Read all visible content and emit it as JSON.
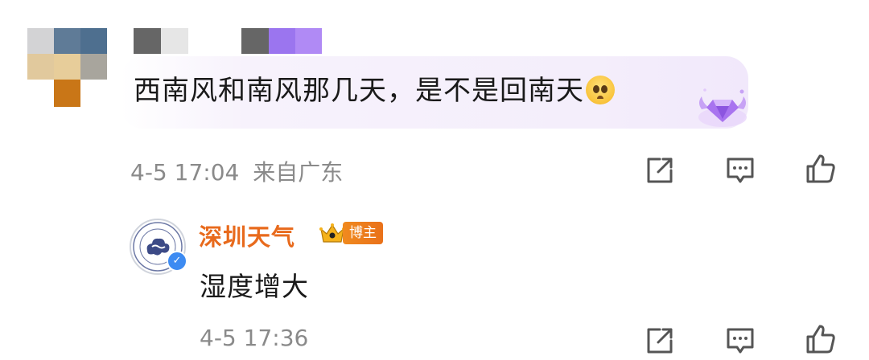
{
  "comment": {
    "text": "西南风和南风那几天，是不是回南天",
    "emoji": "pleading-face-emoji",
    "timestamp": "4-5 17:04",
    "location": "来自广东",
    "avatar_pixel_colors": [
      "#d3d3d5",
      "#5f7b97",
      "#4e6f8f",
      "#a8a59d",
      "#e1c99d",
      "#e7cd9a",
      "#c8b697",
      "#ffffff",
      "#c97617"
    ],
    "username_pixel_colors": [
      "#666666",
      "#e6e6e6",
      "#666666",
      "#9b75ef",
      "#b08af5"
    ]
  },
  "reply": {
    "username": "深圳天气",
    "badge": "博主",
    "text": "湿度增大",
    "timestamp": "4-5 17:36",
    "accent": "#e86a1c"
  },
  "icons": {
    "share": "share-icon",
    "comment": "comment-icon",
    "like": "thumbs-up-icon",
    "gem": "purple-gem-badge-icon",
    "crown": "crown-icon",
    "verified": "verified-icon"
  },
  "colors": {
    "meta_text": "#8a8a8a",
    "bubble": "#f4eefb",
    "verified": "#3d8bf2"
  }
}
